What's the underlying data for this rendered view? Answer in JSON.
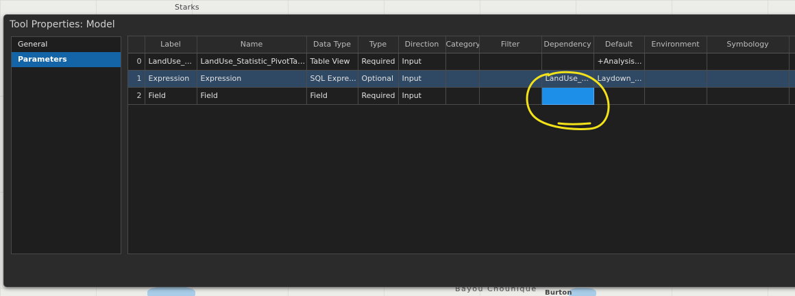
{
  "map": {
    "labels": [
      "Starks",
      "Bayou Chounique",
      "Burton"
    ]
  },
  "dialog": {
    "title": "Tool Properties: Model"
  },
  "nav": {
    "items": [
      {
        "label": "General",
        "active": false
      },
      {
        "label": "Parameters",
        "active": true
      }
    ]
  },
  "table": {
    "columns": [
      "",
      "Label",
      "Name",
      "Data Type",
      "Type",
      "Direction",
      "Category",
      "Filter",
      "Dependency",
      "Default",
      "Environment",
      "Symbology",
      ""
    ],
    "rows": [
      {
        "idx": "0",
        "label": "LandUse_...",
        "name": "LandUse_Statistic_PivotTable",
        "data_type": "Table View",
        "type": "Required",
        "direction": "Input",
        "category": "",
        "filter": "",
        "dependency": "",
        "default": "+Analysis...",
        "environment": "",
        "symbology": ""
      },
      {
        "idx": "1",
        "label": "Expression",
        "name": "Expression",
        "data_type": "SQL Expre...",
        "type": "Optional",
        "direction": "Input",
        "category": "",
        "filter": "",
        "dependency": "LandUse_...",
        "default": "Laydown_...",
        "environment": "",
        "symbology": ""
      },
      {
        "idx": "2",
        "label": "Field",
        "name": "Field",
        "data_type": "Field",
        "type": "Required",
        "direction": "Input",
        "category": "",
        "filter": "",
        "dependency": "",
        "default": "",
        "environment": "",
        "symbology": ""
      }
    ]
  },
  "colors": {
    "selected_row": "#2f4965",
    "highlight_cell": "#1e8fe8",
    "annotation": "#f2e21a",
    "nav_active": "#1464a8"
  }
}
